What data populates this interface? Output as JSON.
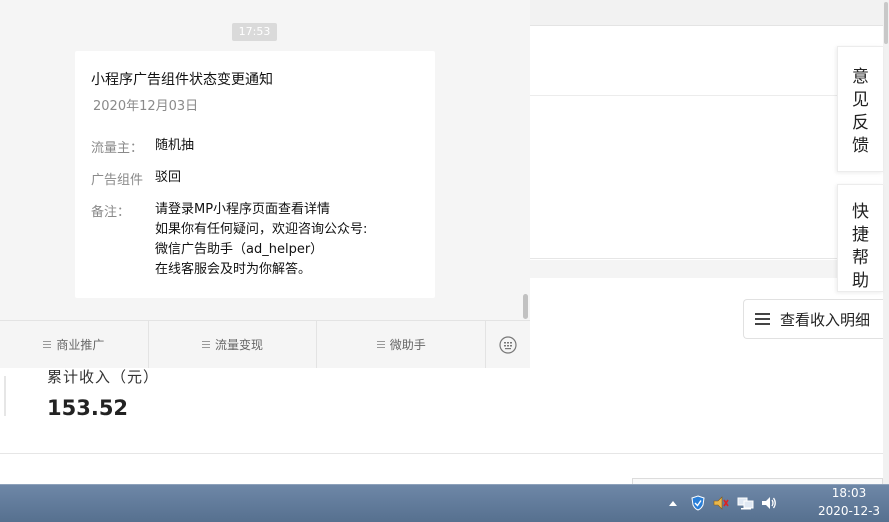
{
  "chat": {
    "time": "17:53",
    "message": {
      "title": "小程序广告组件状态变更通知",
      "date": "2020年12月03日",
      "rows": [
        {
          "label": "流量主：",
          "value": "随机抽"
        },
        {
          "label": "广告组件",
          "value": "驳回"
        },
        {
          "label": "备注：",
          "lines": [
            "请登录MP小程序页面查看详情",
            "如果你有任何疑问，欢迎咨询公众号:",
            "微信广告助手（ad_helper）",
            "在线客服会及时为你解答。"
          ]
        }
      ]
    },
    "menu": [
      {
        "label": "商业推广",
        "icon": "menu-lines-icon"
      },
      {
        "label": "流量变现",
        "icon": "menu-lines-icon"
      },
      {
        "label": "微助手",
        "icon": "menu-lines-icon"
      }
    ],
    "keyboard_icon": "keyboard-icon"
  },
  "page": {
    "income_label": "累计收入（元）",
    "income_value": "153.52",
    "feedback_tab": [
      "意",
      "见",
      "反",
      "馈"
    ],
    "help_tab": [
      "快",
      "捷",
      "帮",
      "助"
    ],
    "income_detail_button": "查看收入明细"
  },
  "taskbar": {
    "time": "18:03",
    "date": "2020-12-3",
    "tray_icons": [
      "show-hidden-icons-arrow",
      "shield-icon",
      "speaker-icon",
      "network-icon",
      "volume-icon"
    ]
  },
  "colors": {
    "chat_background": "#f5f5f5",
    "taskbar": "#5f7897",
    "time_badge": "#dadada"
  }
}
